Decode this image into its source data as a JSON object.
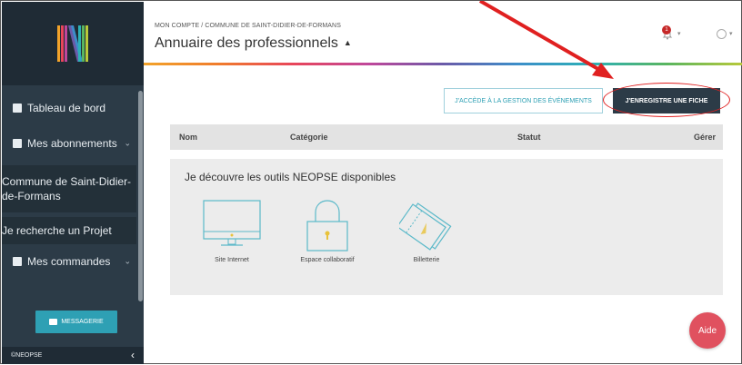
{
  "sidebar": {
    "logo_icon": "neopse-logo-icon",
    "items": [
      {
        "label": "Tableau de bord",
        "icon": "dashboard-icon"
      },
      {
        "label": "Mes abonnements",
        "icon": "subscriptions-icon"
      },
      {
        "label": "Commune de Saint-Didier-de-Formans"
      },
      {
        "label": "Je recherche un Projet"
      },
      {
        "label": "Mes commandes",
        "icon": "orders-icon"
      }
    ],
    "messaging_label": "MESSAGERIE",
    "footer_label": "©NEOPSE",
    "collapse_icon": "‹"
  },
  "header": {
    "breadcrumb": "MON COMPTE / COMMUNE DE SAINT-DIDIER-DE-FORMANS",
    "title": "Annuaire des professionnels",
    "title_caret": "▲",
    "notification_count": "1"
  },
  "actions": {
    "events_label": "J'ACCÈDE À LA GESTION DES ÉVÉNEMENTS",
    "register_label": "J'ENREGISTRE UNE FICHE"
  },
  "table": {
    "columns": [
      "Nom",
      "Catégorie",
      "Statut",
      "Gérer"
    ]
  },
  "tools": {
    "title": "Je découvre les outils NEOPSE disponibles",
    "items": [
      {
        "label": "Site Internet",
        "icon": "monitor-icon"
      },
      {
        "label": "Espace collaboratif",
        "icon": "padlock-icon"
      },
      {
        "label": "Billetterie",
        "icon": "tickets-icon"
      }
    ]
  },
  "help_label": "Aide",
  "colors": {
    "sidebar_bg": "#2c3b47",
    "accent_teal": "#2ea0b4",
    "primary_dark": "#2c3b47",
    "help_red": "#e0515f",
    "annotation_red": "#e02020"
  }
}
